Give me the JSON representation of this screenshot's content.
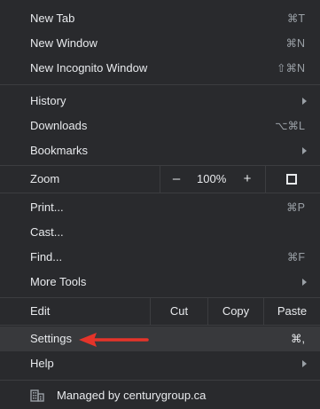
{
  "menu": {
    "new_tab": {
      "label": "New Tab",
      "shortcut": "⌘T"
    },
    "new_window": {
      "label": "New Window",
      "shortcut": "⌘N"
    },
    "new_incognito": {
      "label": "New Incognito Window",
      "shortcut": "⇧⌘N"
    },
    "history": {
      "label": "History"
    },
    "downloads": {
      "label": "Downloads",
      "shortcut": "⌥⌘L"
    },
    "bookmarks": {
      "label": "Bookmarks"
    },
    "zoom": {
      "label": "Zoom",
      "minus": "–",
      "level": "100%",
      "plus": "+"
    },
    "print": {
      "label": "Print...",
      "shortcut": "⌘P"
    },
    "cast": {
      "label": "Cast..."
    },
    "find": {
      "label": "Find...",
      "shortcut": "⌘F"
    },
    "more_tools": {
      "label": "More Tools"
    },
    "edit": {
      "label": "Edit",
      "cut": "Cut",
      "copy": "Copy",
      "paste": "Paste"
    },
    "settings": {
      "label": "Settings",
      "shortcut": "⌘,"
    },
    "help": {
      "label": "Help"
    },
    "managed": {
      "label": "Managed by centurygroup.ca"
    }
  },
  "colors": {
    "background": "#292a2d",
    "highlight": "#38393c",
    "annotation_arrow": "#e5342a"
  },
  "icons": [
    "submenu-arrow-icon",
    "fullscreen-icon",
    "building-icon",
    "red-arrow-annotation"
  ]
}
